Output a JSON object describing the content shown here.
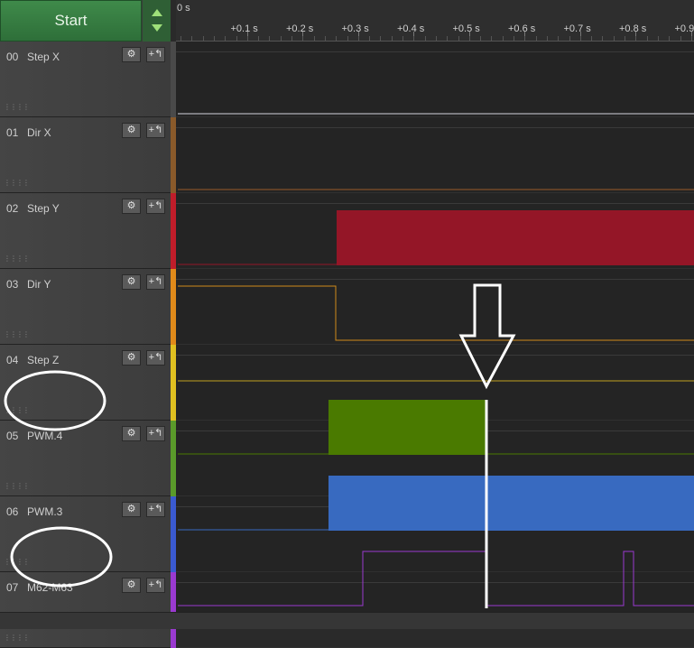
{
  "toolbar": {
    "start_label": "Start"
  },
  "ruler": {
    "start_label": "0 s",
    "ticks": [
      "+0.1 s",
      "+0.2 s",
      "+0.3 s",
      "+0.4 s",
      "+0.5 s",
      "+0.6 s",
      "+0.7 s",
      "+0.8 s",
      "+0.9"
    ]
  },
  "channels": [
    {
      "num": "00",
      "name": "Step X",
      "color": "#4a4a4a"
    },
    {
      "num": "01",
      "name": "Dir X",
      "color": "#8a5a2a"
    },
    {
      "num": "02",
      "name": "Step Y",
      "color": "#c01d2a"
    },
    {
      "num": "03",
      "name": "Dir Y",
      "color": "#e08a1a"
    },
    {
      "num": "04",
      "name": "Step Z",
      "color": "#e0c020"
    },
    {
      "num": "05",
      "name": "PWM.4",
      "color": "#5a9a2a"
    },
    {
      "num": "06",
      "name": "PWM.3",
      "color": "#3a5ad0"
    },
    {
      "num": "07",
      "name": "M62-M63",
      "color": "#9a3ad0"
    }
  ],
  "signal_colors": {
    "step_x": "#9a9aa0",
    "dir_x": "#9a5a2a",
    "step_y": "#941627",
    "dir_y": "#d08a1a",
    "step_z": "#c0a020",
    "pwm4": "#4a7a00",
    "pwm3": "#386ac0",
    "m62": "#9a3ad0"
  },
  "icons": {
    "settings": "gear-icon",
    "trigger": "edge-trigger-icon"
  }
}
